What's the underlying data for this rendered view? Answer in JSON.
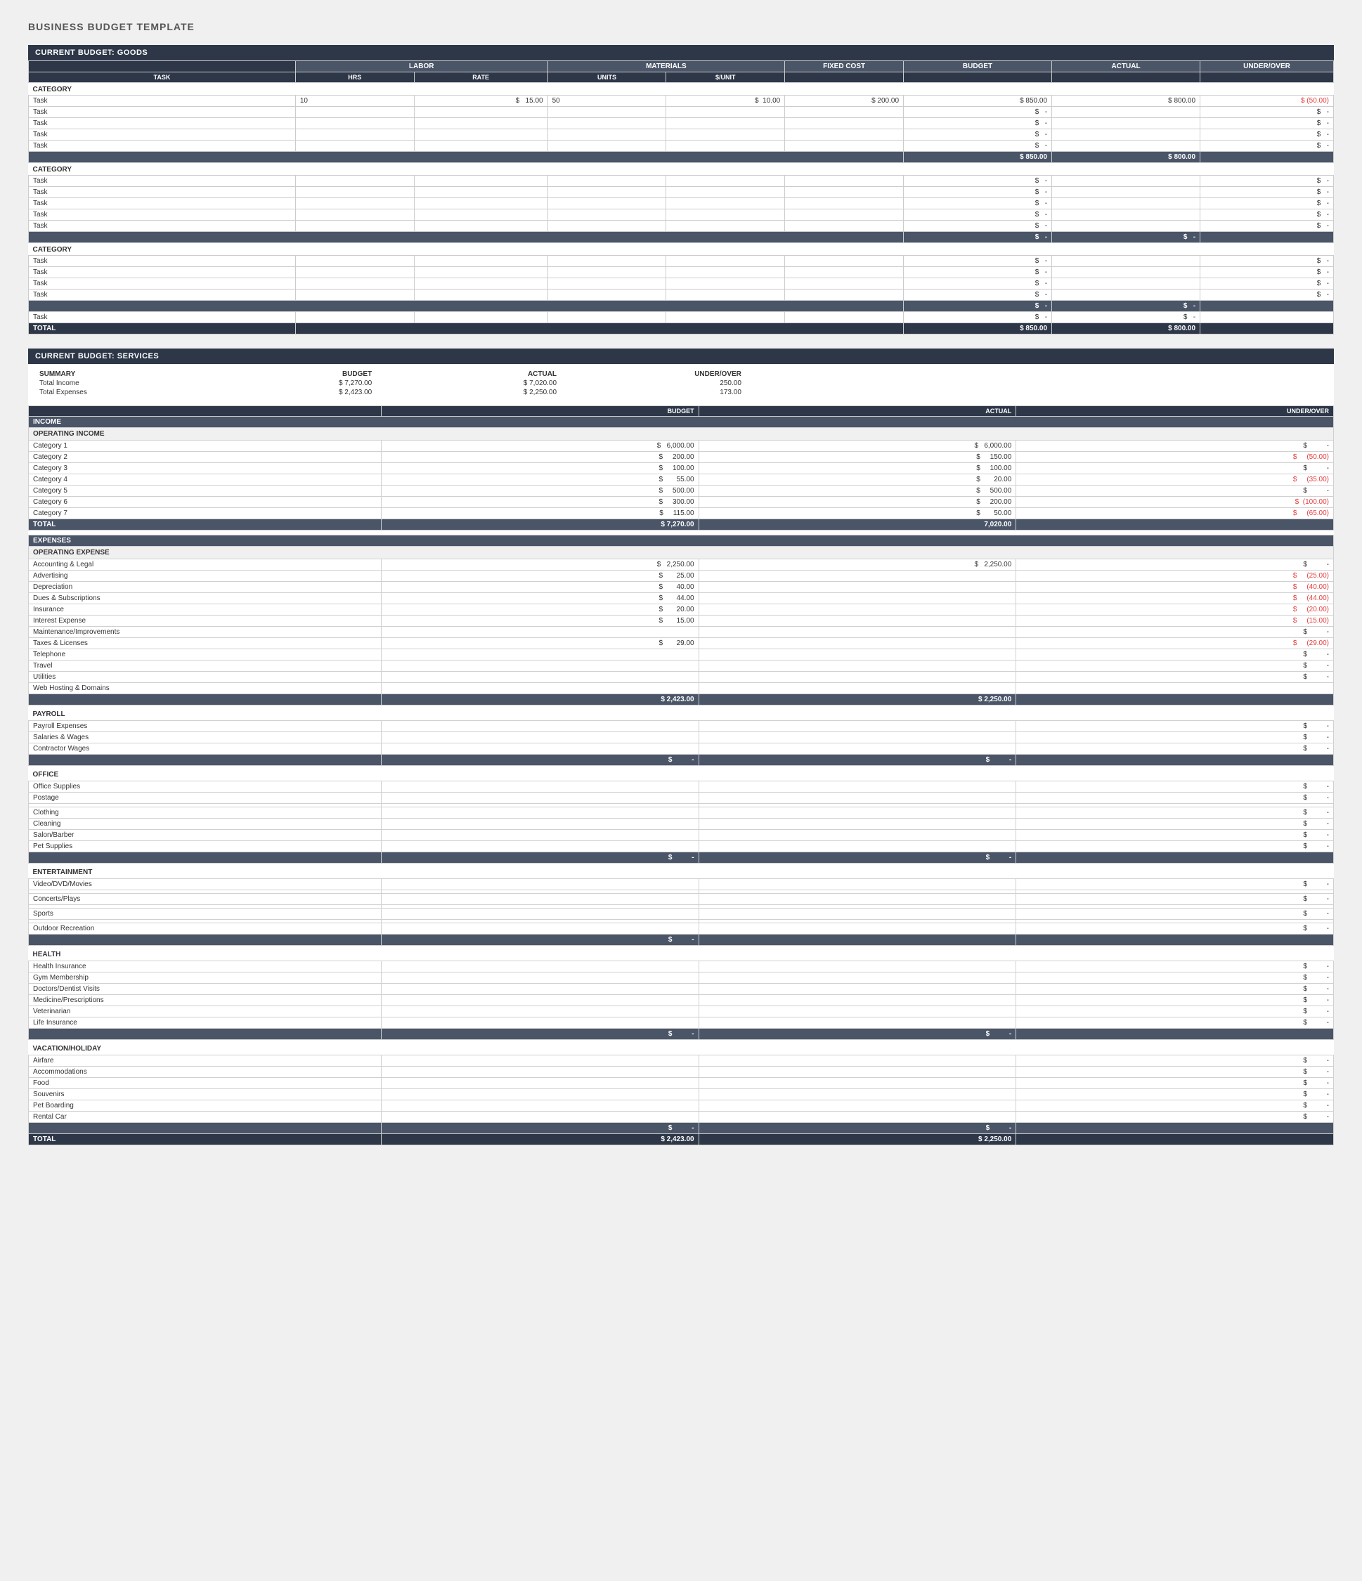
{
  "page": {
    "title": "BUSINESS BUDGET TEMPLATE"
  },
  "goods": {
    "section_title": "CURRENT BUDGET: GOODS",
    "group_headers": [
      "LABOR",
      "MATERIALS",
      "FIXED COST",
      "BUDGET",
      "ACTUAL",
      "UNDER/OVER"
    ],
    "col_headers": [
      "TASK",
      "HRS",
      "RATE",
      "UNITS",
      "$/UNIT",
      "",
      "",
      ""
    ],
    "categories": [
      {
        "label": "CATEGORY",
        "rows": [
          {
            "task": "Task",
            "hrs": "10",
            "rate": "$ 15.00",
            "units": "50",
            "unit_cost": "$ 10.00",
            "fixed": "$ 200.00",
            "budget": "$ 850.00",
            "actual": "$ 800.00",
            "under_over": "(50.00)"
          },
          {
            "task": "Task",
            "hrs": "",
            "rate": "",
            "units": "",
            "unit_cost": "",
            "fixed": "",
            "budget": "$  -",
            "actual": "",
            "under_over": "$  -"
          },
          {
            "task": "Task",
            "hrs": "",
            "rate": "",
            "units": "",
            "unit_cost": "",
            "fixed": "",
            "budget": "$  -",
            "actual": "",
            "under_over": "$  -"
          },
          {
            "task": "Task",
            "hrs": "",
            "rate": "",
            "units": "",
            "unit_cost": "",
            "fixed": "",
            "budget": "$  -",
            "actual": "",
            "under_over": "$  -"
          },
          {
            "task": "Task",
            "hrs": "",
            "rate": "",
            "units": "",
            "unit_cost": "",
            "fixed": "",
            "budget": "$  -",
            "actual": "",
            "under_over": "$  -"
          }
        ],
        "subtotal": {
          "budget": "$ 850.00",
          "actual": "$ 800.00",
          "under_over": ""
        }
      },
      {
        "label": "CATEGORY",
        "rows": [
          {
            "task": "Task",
            "budget": "$  -",
            "under_over": "$  -"
          },
          {
            "task": "Task",
            "budget": "$  -",
            "under_over": "$  -"
          },
          {
            "task": "Task",
            "budget": "$  -",
            "under_over": "$  -"
          },
          {
            "task": "Task",
            "budget": "$  -",
            "under_over": "$  -"
          },
          {
            "task": "Task",
            "budget": "$  -",
            "under_over": "$  -"
          }
        ],
        "subtotal": {
          "budget": "$  -",
          "actual": "$  -",
          "under_over": ""
        }
      },
      {
        "label": "CATEGORY",
        "rows": [
          {
            "task": "Task",
            "budget": "$  -",
            "under_over": "$  -"
          },
          {
            "task": "Task",
            "budget": "$  -",
            "under_over": "$  -"
          },
          {
            "task": "Task",
            "budget": "$  -",
            "under_over": "$  -"
          },
          {
            "task": "Task",
            "budget": "$  -",
            "under_over": "$  -"
          }
        ],
        "subtotal": {
          "budget": "$  -",
          "actual": "$  -",
          "under_over": ""
        }
      },
      {
        "label": "Task",
        "single": true,
        "budget": "$  -",
        "actual": "$  -"
      }
    ],
    "total": {
      "label": "TOTAL",
      "budget": "$ 850.00",
      "actual": "$ 800.00"
    }
  },
  "services": {
    "section_title": "CURRENT BUDGET: SERVICES",
    "summary": {
      "label": "SUMMARY",
      "col1": "BUDGET",
      "col2": "ACTUAL",
      "col3": "UNDER/OVER",
      "rows": [
        {
          "label": "Total Income",
          "budget": "$ 7,270.00",
          "actual": "$ 7,020.00",
          "under_over": "250.00"
        },
        {
          "label": "Total Expenses",
          "budget": "$ 2,423.00",
          "actual": "$ 2,250.00",
          "under_over": "173.00"
        }
      ]
    },
    "income": {
      "section_label": "INCOME",
      "subsection_label": "OPERATING INCOME",
      "categories": [
        {
          "label": "Category 1",
          "budget": "6,000.00",
          "actual": "6,000.00",
          "under_over": "-"
        },
        {
          "label": "Category 2",
          "budget": "200.00",
          "actual": "150.00",
          "under_over": "(50.00)"
        },
        {
          "label": "Category 3",
          "budget": "100.00",
          "actual": "100.00",
          "under_over": "-"
        },
        {
          "label": "Category 4",
          "budget": "55.00",
          "actual": "20.00",
          "under_over": "(35.00)"
        },
        {
          "label": "Category 5",
          "budget": "500.00",
          "actual": "500.00",
          "under_over": "-"
        },
        {
          "label": "Category 6",
          "budget": "300.00",
          "actual": "200.00",
          "under_over": "(100.00)"
        },
        {
          "label": "Category 7",
          "budget": "115.00",
          "actual": "50.00",
          "under_over": "(65.00)"
        }
      ],
      "total": {
        "label": "TOTAL",
        "budget": "$ 7,270.00",
        "actual": "7,020.00"
      }
    },
    "expenses": {
      "section_label": "EXPENSES",
      "subsection_label": "OPERATING EXPENSE",
      "operating": [
        {
          "label": "Accounting & Legal",
          "budget": "2,250.00",
          "actual": "2,250.00",
          "under_over": "-"
        },
        {
          "label": "Advertising",
          "budget": "25.00",
          "actual": "",
          "under_over": "(25.00)"
        },
        {
          "label": "Depreciation",
          "budget": "40.00",
          "actual": "",
          "under_over": "(40.00)"
        },
        {
          "label": "Dues & Subscriptions",
          "budget": "44.00",
          "actual": "",
          "under_over": "(44.00)"
        },
        {
          "label": "Insurance",
          "budget": "20.00",
          "actual": "",
          "under_over": "(20.00)"
        },
        {
          "label": "Interest Expense",
          "budget": "15.00",
          "actual": "",
          "under_over": "(15.00)"
        },
        {
          "label": "Maintenance/Improvements",
          "budget": "",
          "actual": "",
          "under_over": "-"
        },
        {
          "label": "Taxes & Licenses",
          "budget": "29.00",
          "actual": "",
          "under_over": "(29.00)"
        },
        {
          "label": "Telephone",
          "budget": "",
          "actual": "",
          "under_over": "-"
        },
        {
          "label": "Travel",
          "budget": "",
          "actual": "",
          "under_over": "-"
        },
        {
          "label": "Utilities",
          "budget": "",
          "actual": "",
          "under_over": "-"
        },
        {
          "label": "Web Hosting & Domains",
          "budget": "",
          "actual": "",
          "under_over": ""
        }
      ],
      "operating_total": {
        "budget": "$ 2,423.00",
        "actual": "$ 2,250.00"
      },
      "payroll": {
        "label": "PAYROLL",
        "items": [
          {
            "label": "Payroll Expenses",
            "under_over": "-"
          },
          {
            "label": "Salaries & Wages",
            "under_over": "-"
          },
          {
            "label": "Contractor Wages",
            "under_over": "-"
          }
        ],
        "total": {
          "budget": "$  -",
          "actual": "$  -"
        }
      },
      "office": {
        "label": "OFFICE",
        "items": [
          {
            "label": "Office Supplies",
            "under_over": "-"
          },
          {
            "label": "Postage",
            "under_over": "-"
          },
          {
            "label": "",
            "under_over": ""
          },
          {
            "label": "Clothing",
            "under_over": "-"
          },
          {
            "label": "Cleaning",
            "under_over": "-"
          },
          {
            "label": "Salon/Barber",
            "under_over": "-"
          },
          {
            "label": "Pet Supplies",
            "under_over": "-"
          }
        ],
        "total": {
          "budget": "$  -",
          "actual": "$  -"
        }
      },
      "entertainment": {
        "label": "ENTERTAINMENT",
        "items": [
          {
            "label": "Video/DVD/Movies",
            "under_over": "-"
          },
          {
            "label": "",
            "under_over": ""
          },
          {
            "label": "Concerts/Plays",
            "under_over": "-"
          },
          {
            "label": "",
            "under_over": ""
          },
          {
            "label": "Sports",
            "under_over": "-"
          },
          {
            "label": "",
            "under_over": ""
          },
          {
            "label": "Outdoor Recreation",
            "under_over": "-"
          }
        ],
        "total": {
          "budget": "$  -",
          "actual": ""
        }
      },
      "health": {
        "label": "HEALTH",
        "items": [
          {
            "label": "Health Insurance",
            "under_over": "-"
          },
          {
            "label": "Gym Membership",
            "under_over": "-"
          },
          {
            "label": "Doctors/Dentist Visits",
            "under_over": "-"
          },
          {
            "label": "Medicine/Prescriptions",
            "under_over": "-"
          },
          {
            "label": "Veterinarian",
            "under_over": "-"
          },
          {
            "label": "Life Insurance",
            "under_over": "-"
          }
        ],
        "total": {
          "budget": "$  -",
          "actual": "$  -"
        }
      },
      "vacation": {
        "label": "VACATION/HOLIDAY",
        "items": [
          {
            "label": "Airfare",
            "under_over": "-"
          },
          {
            "label": "Accommodations",
            "under_over": "-"
          },
          {
            "label": "Food",
            "under_over": "-"
          },
          {
            "label": "Souvenirs",
            "under_over": "-"
          },
          {
            "label": "Pet Boarding",
            "under_over": "-"
          },
          {
            "label": "Rental Car",
            "under_over": "-"
          }
        ],
        "total": {
          "budget": "$  -",
          "actual": "$  -"
        }
      },
      "grand_total": {
        "label": "TOTAL",
        "budget": "$ 2,423.00",
        "actual": "$ 2,250.00"
      }
    }
  }
}
